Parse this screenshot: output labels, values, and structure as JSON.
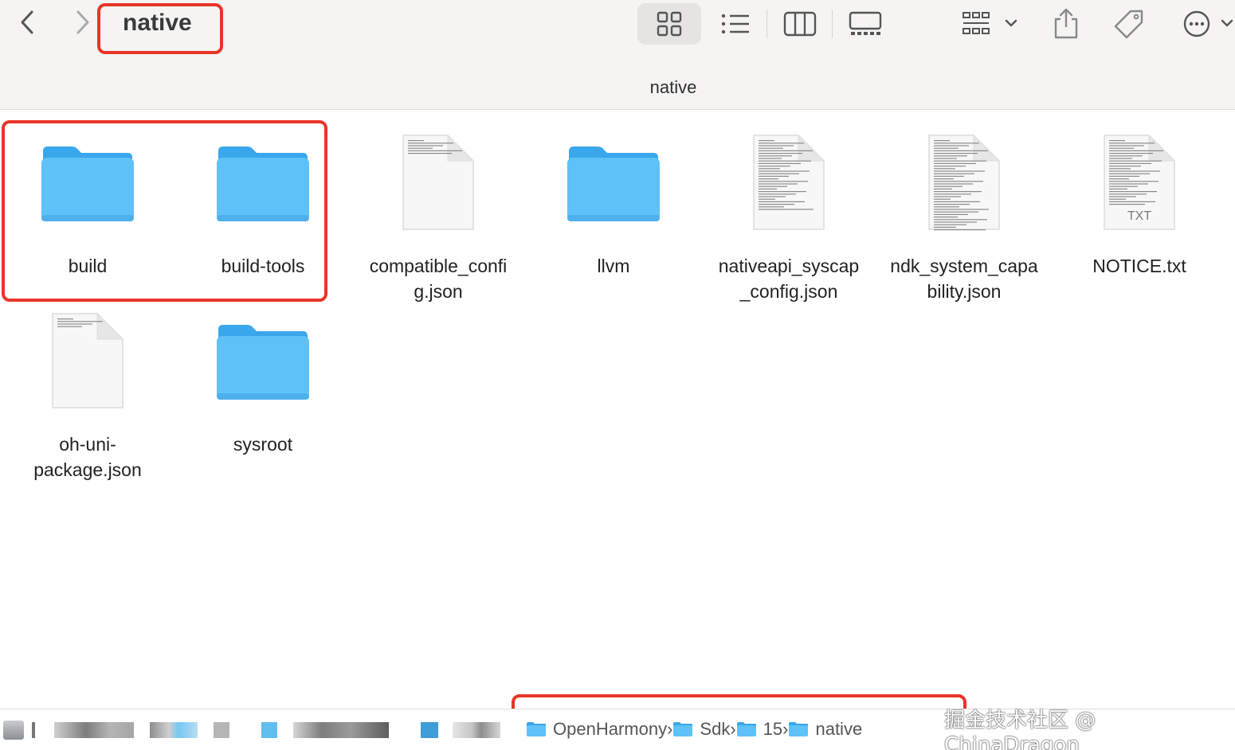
{
  "window": {
    "title": "native",
    "path_title": "native"
  },
  "toolbar": {
    "back_icon": "chevron-left-icon",
    "forward_icon": "chevron-right-icon",
    "view_icons": [
      "icon-view-icon",
      "list-view-icon",
      "column-view-icon",
      "gallery-view-icon"
    ],
    "group_icon": "group-by-icon",
    "share_icon": "share-icon",
    "tag_icon": "tag-icon",
    "more_icon": "more-options-icon"
  },
  "files": [
    {
      "name": "build",
      "kind": "folder"
    },
    {
      "name": "build-tools",
      "kind": "folder"
    },
    {
      "name": "compatible_config.json",
      "kind": "document",
      "label_lines": [
        "compatible_confi",
        "g.json"
      ]
    },
    {
      "name": "llvm",
      "kind": "folder"
    },
    {
      "name": "nativeapi_syscap_config.json",
      "kind": "document",
      "label_lines": [
        "nativeapi_syscap",
        "_config.json"
      ]
    },
    {
      "name": "ndk_system_capability.json",
      "kind": "document",
      "label_lines": [
        "ndk_system_capa",
        "bility.json"
      ]
    },
    {
      "name": "NOTICE.txt",
      "kind": "text",
      "badge": "TXT"
    },
    {
      "name": "oh-uni-package.json",
      "kind": "document",
      "label_lines": [
        "oh-uni-",
        "package.json"
      ]
    },
    {
      "name": "sysroot",
      "kind": "folder"
    }
  ],
  "pathbar": {
    "crumbs": [
      "OpenHarmony",
      "Sdk",
      "15",
      "native"
    ],
    "separator": "›"
  },
  "watermark": "掘金技术社区 @ ChinaDragon",
  "colors": {
    "highlight": "#e8352a",
    "folder": "#5ec1f7",
    "folder_tab": "#3aa6eb"
  }
}
